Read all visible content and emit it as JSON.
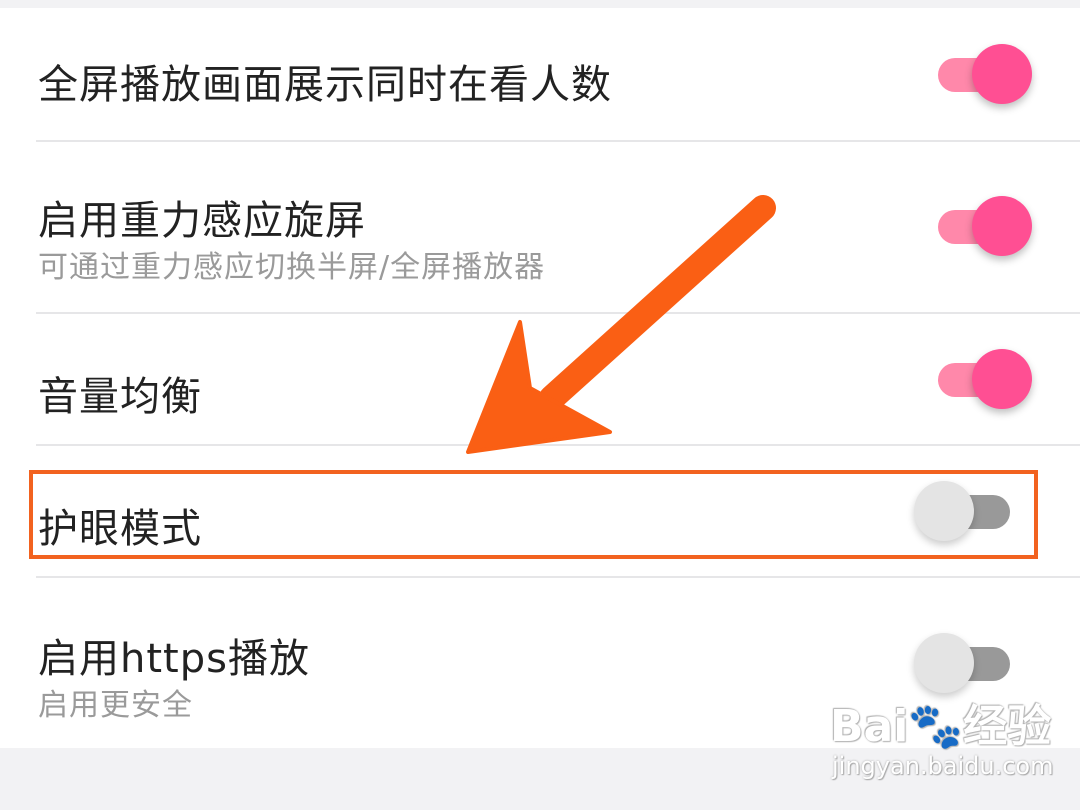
{
  "settings": {
    "items": [
      {
        "title": "全屏播放画面展示同时在看人数",
        "subtitle": "",
        "enabled": true
      },
      {
        "title": "启用重力感应旋屏",
        "subtitle": "可通过重力感应切换半屏/全屏播放器",
        "enabled": true
      },
      {
        "title": "音量均衡",
        "subtitle": "",
        "enabled": true
      },
      {
        "title": "护眼模式",
        "subtitle": "",
        "enabled": false
      },
      {
        "title": "启用https播放",
        "subtitle": "启用更安全",
        "enabled": false
      }
    ]
  },
  "annotation": {
    "highlight_color": "#f2621f",
    "arrow_color": "#fa5f14",
    "highlighted_item": "护眼模式"
  },
  "colors": {
    "toggle_on_knob": "#ff4f93",
    "toggle_on_track": "#ff88aa",
    "toggle_off_knob": "#e4e4e4",
    "toggle_off_track": "#999999"
  },
  "watermark": {
    "brand": "Bai",
    "brand_suffix": "经验",
    "url": "jingyan.baidu.com"
  }
}
